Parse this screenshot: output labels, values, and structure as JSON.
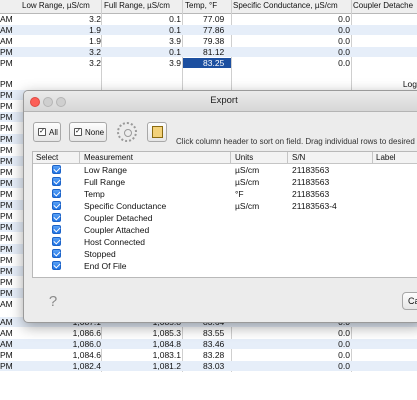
{
  "table": {
    "columns": {
      "low_range": "Low Range, µS/cm",
      "full_range": "Full Range, µS/cm",
      "temp": "Temp, °F",
      "spc": "Specific Conductance, µS/cm",
      "coupler_detached": "Coupler Detache"
    },
    "top_rows": [
      {
        "time": "AM",
        "low": "3.2",
        "full": "0.1",
        "temp": "77.09",
        "spc": "0.0"
      },
      {
        "time": "AM",
        "low": "1.9",
        "full": "0.1",
        "temp": "77.86",
        "spc": "0.0"
      },
      {
        "time": "AM",
        "low": "1.9",
        "full": "3.9",
        "temp": "79.38",
        "spc": "0.0"
      },
      {
        "time": "PM",
        "low": "3.2",
        "full": "0.1",
        "temp": "81.12",
        "spc": "0.0"
      },
      {
        "time": "PM",
        "low": "3.2",
        "full": "3.9",
        "temp": "83.25",
        "spc": "0.0"
      }
    ],
    "side_times": [
      "PM",
      "PM",
      "PM",
      "PM",
      "PM",
      "PM",
      "PM",
      "PM",
      "PM",
      "PM",
      "PM",
      "PM",
      "PM",
      "PM",
      "PM",
      "PM",
      "PM",
      "PM",
      "PM",
      "PM",
      "AM"
    ],
    "log_label": "Log",
    "bottom_rows": [
      {
        "time": "AM",
        "low": "1,087.1",
        "full": "1,085.8",
        "temp": "83.64",
        "spc": "0.0"
      },
      {
        "time": "AM",
        "low": "1,086.6",
        "full": "1,085.3",
        "temp": "83.55",
        "spc": "0.0"
      },
      {
        "time": "AM",
        "low": "1,086.0",
        "full": "1,084.8",
        "temp": "83.46",
        "spc": "0.0"
      },
      {
        "time": "PM",
        "low": "1,084.6",
        "full": "1,083.1",
        "temp": "83.28",
        "spc": "0.0"
      },
      {
        "time": "PM",
        "low": "1,082.4",
        "full": "1,081.2",
        "temp": "83.03",
        "spc": "0.0"
      }
    ]
  },
  "dialog": {
    "title": "Export",
    "all_label": "All",
    "none_label": "None",
    "hint": "Click column header to sort on field. Drag individual rows to desired o",
    "headers": {
      "select": "Select",
      "measurement": "Measurement",
      "units": "Units",
      "sn": "S/N",
      "label": "Label"
    },
    "rows": [
      {
        "measurement": "Low Range",
        "units": "µS/cm",
        "sn": "21183563"
      },
      {
        "measurement": "Full Range",
        "units": "µS/cm",
        "sn": "21183563"
      },
      {
        "measurement": "Temp",
        "units": "°F",
        "sn": "21183563"
      },
      {
        "measurement": "Specific Conductance",
        "units": "µS/cm",
        "sn": "21183563-4"
      },
      {
        "measurement": "Coupler Detached",
        "units": "",
        "sn": ""
      },
      {
        "measurement": "Coupler Attached",
        "units": "",
        "sn": ""
      },
      {
        "measurement": "Host Connected",
        "units": "",
        "sn": ""
      },
      {
        "measurement": "Stopped",
        "units": "",
        "sn": ""
      },
      {
        "measurement": "End Of File",
        "units": "",
        "sn": ""
      }
    ],
    "help_glyph": "?",
    "cancel_label": "Ca"
  }
}
